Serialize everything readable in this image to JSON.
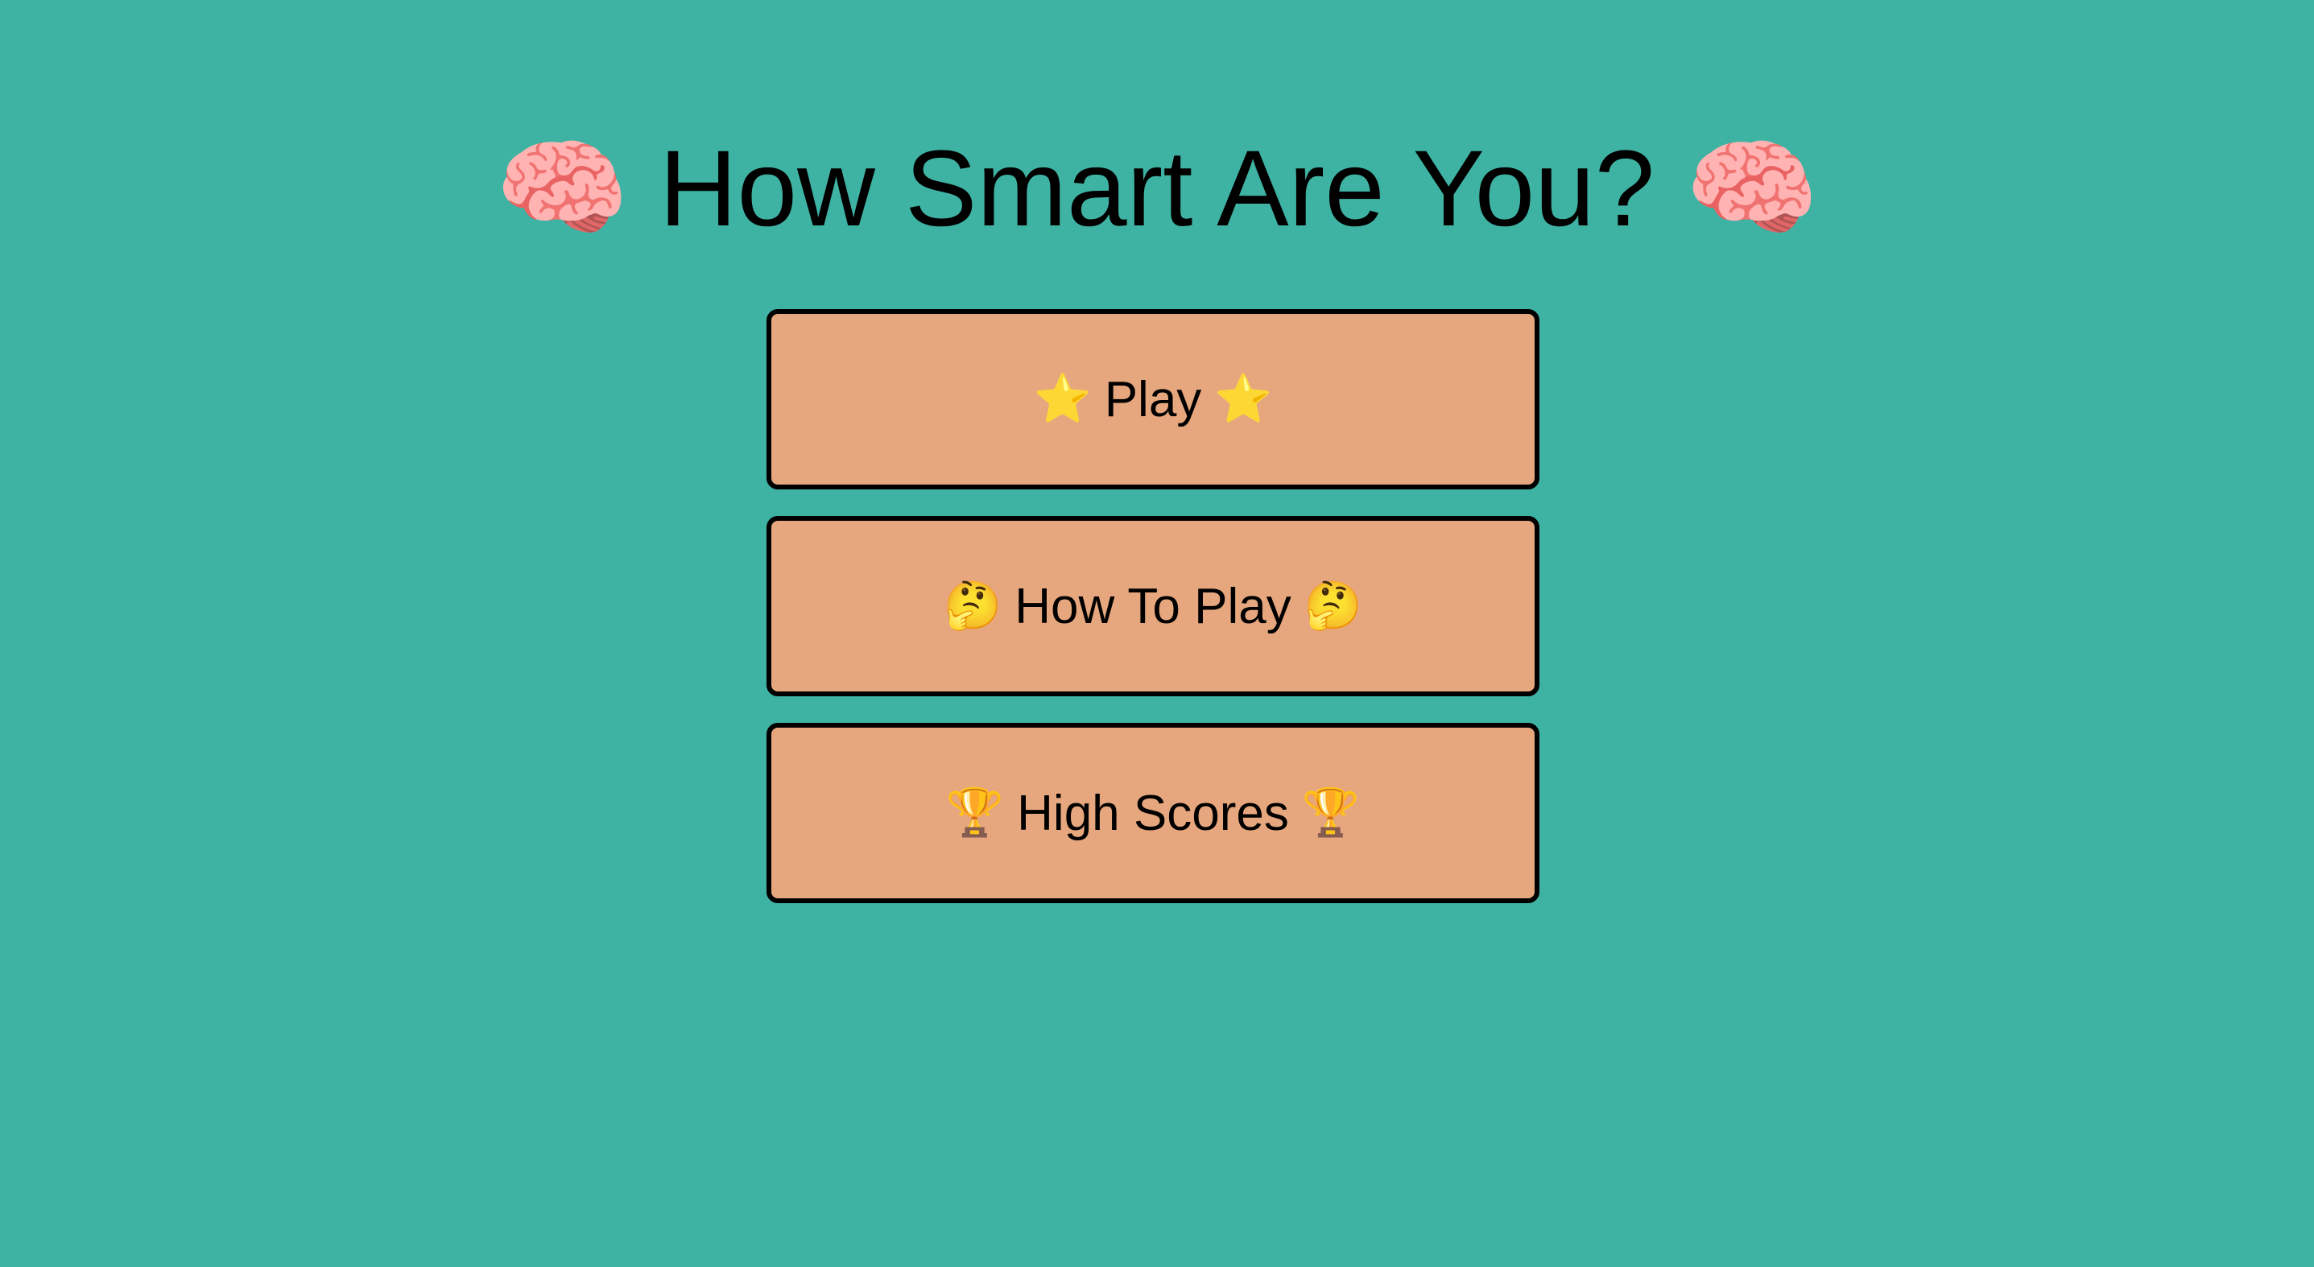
{
  "title": {
    "emoji": "🧠",
    "text": "How Smart Are You?",
    "icon": "brain-icon"
  },
  "menu": [
    {
      "label": "Play",
      "emoji": "⭐",
      "icon": "star-icon"
    },
    {
      "label": "How To Play",
      "emoji": "🤔",
      "icon": "thinking-face-icon"
    },
    {
      "label": "High Scores",
      "emoji": "🏆",
      "icon": "trophy-icon"
    }
  ],
  "colors": {
    "background": "#3eb3a3",
    "button": "#e7a77e",
    "border": "#000000"
  }
}
